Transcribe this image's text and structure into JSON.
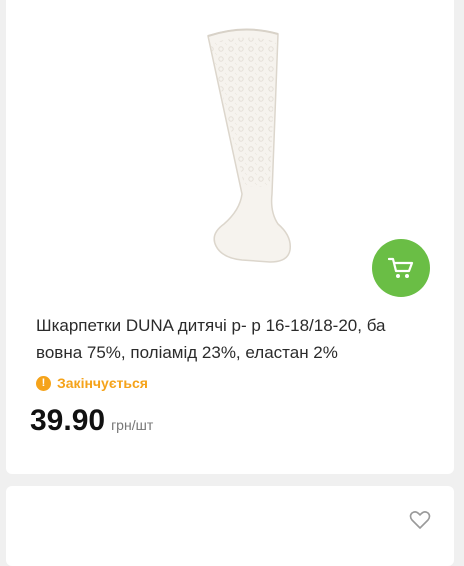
{
  "product": {
    "title": "Шкарпетки DUNA дитячі р- р 16-18/18-20, ба вовна 75%, поліамід 23%, еластан 2%",
    "status": "Закінчується",
    "price": "39.90",
    "unit": "грн/шт"
  },
  "icons": {
    "cart": "cart-icon",
    "status": "exclamation-icon",
    "favorite": "heart-icon"
  },
  "colors": {
    "accent_green": "#6abe45",
    "status_orange": "#f5a31a",
    "background": "#f0f0f0"
  }
}
